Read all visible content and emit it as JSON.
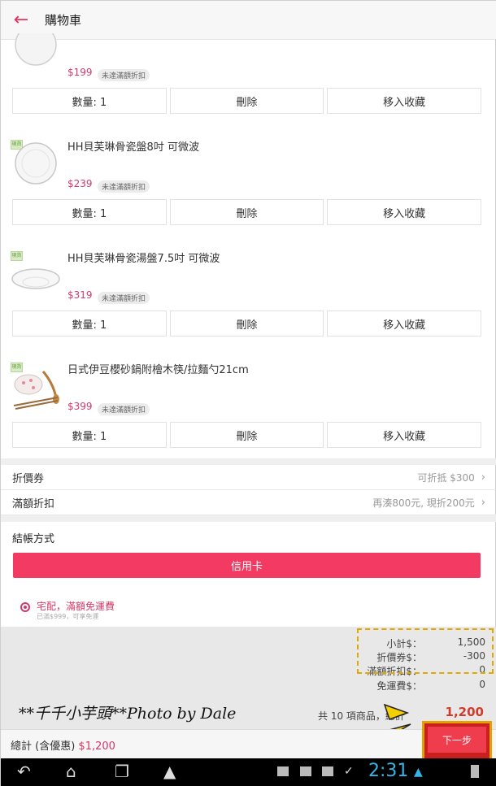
{
  "header": {
    "title": "購物車",
    "back_icon": "arrow-left-icon"
  },
  "items": [
    {
      "name": "",
      "price": "$199",
      "badge": "未達滿額折扣",
      "tag": "",
      "buttons": [
        "數量: 1",
        "刪除",
        "移入收藏"
      ]
    },
    {
      "name": "HH貝芙琳骨瓷盤8吋 可微波",
      "price": "$239",
      "badge": "未達滿額折扣",
      "tag": "現貨",
      "buttons": [
        "數量: 1",
        "刪除",
        "移入收藏"
      ]
    },
    {
      "name": "HH貝芙琳骨瓷湯盤7.5吋 可微波",
      "price": "$319",
      "badge": "未達滿額折扣",
      "tag": "現貨",
      "buttons": [
        "數量: 1",
        "刪除",
        "移入收藏"
      ]
    },
    {
      "name": "日式伊豆櫻砂鍋附檜木筷/拉麵勺21cm",
      "price": "$399",
      "badge": "未達滿額折扣",
      "tag": "現貨",
      "buttons": [
        "數量: 1",
        "刪除",
        "移入收藏"
      ]
    }
  ],
  "coupon": {
    "label": "折價券",
    "value": "可折抵 $300"
  },
  "discount": {
    "label": "滿額折扣",
    "value": "再湊800元, 現折200元"
  },
  "payment": {
    "title": "結帳方式",
    "method": "信用卡"
  },
  "delivery": {
    "label": "宅配，滿額免運費",
    "note": "已滿$999，可享免運"
  },
  "summary": {
    "subtotal_label": "小計$：",
    "subtotal": "1,500",
    "coupon_label": "折價券$：",
    "coupon": "-300",
    "bulk_label": "滿額折扣$：",
    "bulk": "0",
    "shipping_label": "免運費$：",
    "shipping": "0",
    "count": "共 10 項商品，總計",
    "total": "1,200"
  },
  "watermark": "**千千小芋頭**Photo by Dale",
  "bottom": {
    "total_label": "總計 (含優惠)",
    "total_value": "$1,200",
    "next": "下一步"
  },
  "statusbar": {
    "time": "2:31"
  },
  "colors": {
    "accent": "#f23a62",
    "price": "#d23a6a",
    "highlight": "#e8a000",
    "clock": "#35b5e5"
  }
}
